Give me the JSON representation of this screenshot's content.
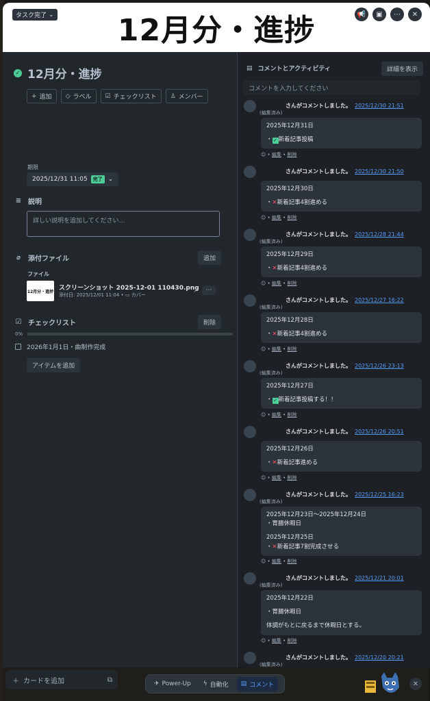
{
  "cover": {
    "title": "12月分・進捗",
    "status_label": "タスク完了",
    "icons": [
      "megaphone-icon",
      "image-icon",
      "more-icon",
      "close-icon"
    ]
  },
  "card": {
    "title": "12月分・進捗",
    "actions": [
      {
        "label": "追加",
        "icon": "plus-icon"
      },
      {
        "label": "ラベル",
        "icon": "tag-icon"
      },
      {
        "label": "チェックリスト",
        "icon": "checklist-icon"
      },
      {
        "label": "メンバー",
        "icon": "person-icon"
      }
    ],
    "due": {
      "heading": "期限",
      "value": "2025/12/31 11:05",
      "badge": "完了"
    },
    "description": {
      "heading": "説明",
      "placeholder": "詳しい説明を追加してください…"
    },
    "attachments": {
      "heading": "添付ファイル",
      "add_label": "追加",
      "files_heading": "ファイル",
      "file": {
        "thumb_text": "12月分・進捗",
        "name": "スクリーンショット 2025-12-01 110430.png",
        "meta": "添付日: 2025/12/01 11:04 • ",
        "cover_label": "カバー"
      }
    },
    "checklist": {
      "heading": "チェックリスト",
      "delete_label": "削除",
      "progress_text": "0%",
      "progress": 0,
      "items": [
        "2026年1月1日・曲制作完成"
      ],
      "add_item_label": "アイテムを追加"
    }
  },
  "comments_panel": {
    "heading": "コメントとアクティビティ",
    "detail_button": "詳細を表示",
    "input_placeholder": "コメントを入力してください",
    "comment_suffix": "さんがコメントしました。",
    "edited_label": "(編集済み)",
    "edit_label": "編集",
    "delete_label": "削除",
    "comments": [
      {
        "date": "2025/12/30 21:51",
        "edited": true,
        "lines": [
          {
            "t": "2025年12月31日"
          },
          {
            "gap": true
          },
          {
            "mark": "ok",
            "t": "新着記事投稿"
          }
        ]
      },
      {
        "date": "2025/12/30 21:50",
        "edited": false,
        "lines": [
          {
            "t": "2025年12月30日"
          },
          {
            "gap": true
          },
          {
            "mark": "ng",
            "t": "新着記事4割進める"
          }
        ]
      },
      {
        "date": "2025/12/28 21:44",
        "edited": true,
        "lines": [
          {
            "t": "2025年12月29日"
          },
          {
            "gap": true
          },
          {
            "mark": "ng",
            "t": "新着記事4割進める"
          }
        ]
      },
      {
        "date": "2025/12/27 16:22",
        "edited": true,
        "lines": [
          {
            "t": "2025年12月28日"
          },
          {
            "gap": true
          },
          {
            "mark": "ng",
            "t": "新着記事4割進める"
          }
        ]
      },
      {
        "date": "2025/12/26 23:13",
        "edited": true,
        "lines": [
          {
            "t": "2025年12月27日"
          },
          {
            "gap": true
          },
          {
            "mark": "ok",
            "t": "新着記事投稿する！！"
          }
        ]
      },
      {
        "date": "2025/12/26 20:51",
        "edited": false,
        "lines": [
          {
            "t": "2025年12月26日"
          },
          {
            "gap": true
          },
          {
            "mark": "ng",
            "t": "新着記事進める"
          }
        ]
      },
      {
        "date": "2025/12/25 16:23",
        "edited": true,
        "lines": [
          {
            "t": "2025年12月23日〜2025年12月24日"
          },
          {
            "t": "・胃腸休暇日"
          },
          {
            "gap": true
          },
          {
            "t": "2025年12月25日"
          },
          {
            "mark": "ng",
            "t": "新着記事7割完成させる"
          }
        ]
      },
      {
        "date": "2025/12/21 20:01",
        "edited": true,
        "lines": [
          {
            "t": "2025年12月22日"
          },
          {
            "gap": true
          },
          {
            "t": "・胃腸休暇日"
          },
          {
            "gap": true
          },
          {
            "t": "体調がもとに戻るまで休暇日とする。"
          }
        ]
      },
      {
        "date": "2025/12/20 20:21",
        "edited": true,
        "lines": [
          {
            "t": "2025年12月21日"
          }
        ]
      }
    ]
  },
  "board": {
    "add_card_label": "カードを追加"
  },
  "bottom_bar": {
    "items": [
      {
        "label": "Power-Up",
        "icon": "rocket-icon",
        "active": false
      },
      {
        "label": "自動化",
        "icon": "lightning-icon",
        "active": false
      },
      {
        "label": "コメント",
        "icon": "comment-icon",
        "active": true
      }
    ]
  },
  "colors": {
    "accent": "#579dff",
    "success": "#4bce97",
    "danger": "#f15a5a"
  }
}
